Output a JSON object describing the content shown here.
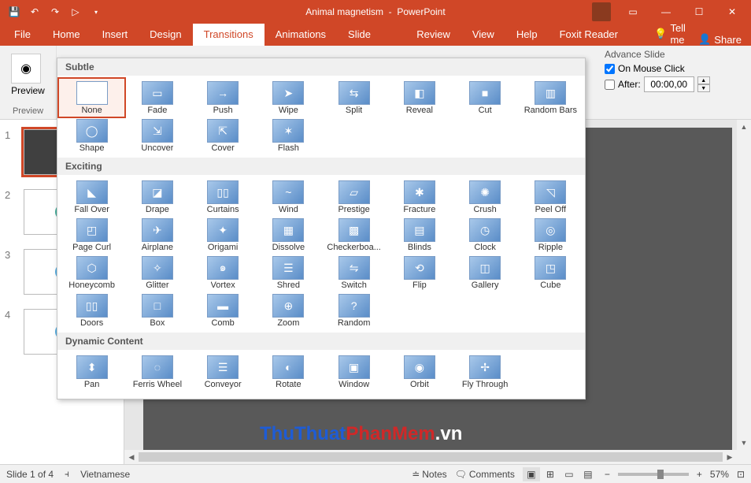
{
  "title": {
    "doc": "Animal magnetism",
    "app": "PowerPoint"
  },
  "tabs": [
    "File",
    "Home",
    "Insert",
    "Design",
    "Transitions",
    "Animations",
    "Slide Show",
    "Review",
    "View",
    "Help",
    "Foxit Reader PDF"
  ],
  "active_tab": "Transitions",
  "tell_me": "Tell me",
  "share": "Share",
  "ribbon": {
    "preview_group": "Preview",
    "preview_btn": "Preview"
  },
  "advance": {
    "title": "Advance Slide",
    "mouse": "On Mouse Click",
    "mouse_checked": true,
    "after": "After:",
    "after_checked": false,
    "time": "00:00,00"
  },
  "gallery": {
    "sections": [
      {
        "header": "Subtle",
        "items": [
          {
            "label": "None",
            "glyph": "",
            "none": true
          },
          {
            "label": "Fade",
            "glyph": "▭"
          },
          {
            "label": "Push",
            "glyph": "→"
          },
          {
            "label": "Wipe",
            "glyph": "➤"
          },
          {
            "label": "Split",
            "glyph": "⇆"
          },
          {
            "label": "Reveal",
            "glyph": "◧"
          },
          {
            "label": "Cut",
            "glyph": "■"
          },
          {
            "label": "Random Bars",
            "glyph": "▥"
          },
          {
            "label": "Shape",
            "glyph": "◯"
          },
          {
            "label": "Uncover",
            "glyph": "⇲"
          },
          {
            "label": "Cover",
            "glyph": "⇱"
          },
          {
            "label": "Flash",
            "glyph": "✶"
          }
        ]
      },
      {
        "header": "Exciting",
        "items": [
          {
            "label": "Fall Over",
            "glyph": "◣"
          },
          {
            "label": "Drape",
            "glyph": "◪"
          },
          {
            "label": "Curtains",
            "glyph": "▯▯"
          },
          {
            "label": "Wind",
            "glyph": "~"
          },
          {
            "label": "Prestige",
            "glyph": "▱"
          },
          {
            "label": "Fracture",
            "glyph": "✱"
          },
          {
            "label": "Crush",
            "glyph": "✺"
          },
          {
            "label": "Peel Off",
            "glyph": "◹"
          },
          {
            "label": "Page Curl",
            "glyph": "◰"
          },
          {
            "label": "Airplane",
            "glyph": "✈"
          },
          {
            "label": "Origami",
            "glyph": "✦"
          },
          {
            "label": "Dissolve",
            "glyph": "▦"
          },
          {
            "label": "Checkerboa...",
            "glyph": "▩"
          },
          {
            "label": "Blinds",
            "glyph": "▤"
          },
          {
            "label": "Clock",
            "glyph": "◷"
          },
          {
            "label": "Ripple",
            "glyph": "◎"
          },
          {
            "label": "Honeycomb",
            "glyph": "⬡"
          },
          {
            "label": "Glitter",
            "glyph": "✧"
          },
          {
            "label": "Vortex",
            "glyph": "๑"
          },
          {
            "label": "Shred",
            "glyph": "☰"
          },
          {
            "label": "Switch",
            "glyph": "⇋"
          },
          {
            "label": "Flip",
            "glyph": "⟲"
          },
          {
            "label": "Gallery",
            "glyph": "◫"
          },
          {
            "label": "Cube",
            "glyph": "◳"
          },
          {
            "label": "Doors",
            "glyph": "▯▯"
          },
          {
            "label": "Box",
            "glyph": "□"
          },
          {
            "label": "Comb",
            "glyph": "▬"
          },
          {
            "label": "Zoom",
            "glyph": "⊕"
          },
          {
            "label": "Random",
            "glyph": "?"
          }
        ]
      },
      {
        "header": "Dynamic Content",
        "items": [
          {
            "label": "Pan",
            "glyph": "⬍"
          },
          {
            "label": "Ferris Wheel",
            "glyph": "◌"
          },
          {
            "label": "Conveyor",
            "glyph": "☰"
          },
          {
            "label": "Rotate",
            "glyph": "◐"
          },
          {
            "label": "Window",
            "glyph": "▣"
          },
          {
            "label": "Orbit",
            "glyph": "◉"
          },
          {
            "label": "Fly Through",
            "glyph": "✢"
          }
        ]
      }
    ],
    "selected": "None"
  },
  "thumbnails": [
    {
      "num": "1",
      "dark": true,
      "selected": true
    },
    {
      "num": "2",
      "dark": false,
      "selected": false
    },
    {
      "num": "3",
      "dark": false,
      "selected": false
    },
    {
      "num": "4",
      "dark": false,
      "selected": false
    }
  ],
  "status": {
    "slide": "Slide 1 of 4",
    "lang": "Vietnamese",
    "notes": "Notes",
    "comments": "Comments",
    "zoom": "57%"
  },
  "watermark": {
    "a": "ThuThuat",
    "b": "PhanMem",
    "c": ".vn"
  }
}
